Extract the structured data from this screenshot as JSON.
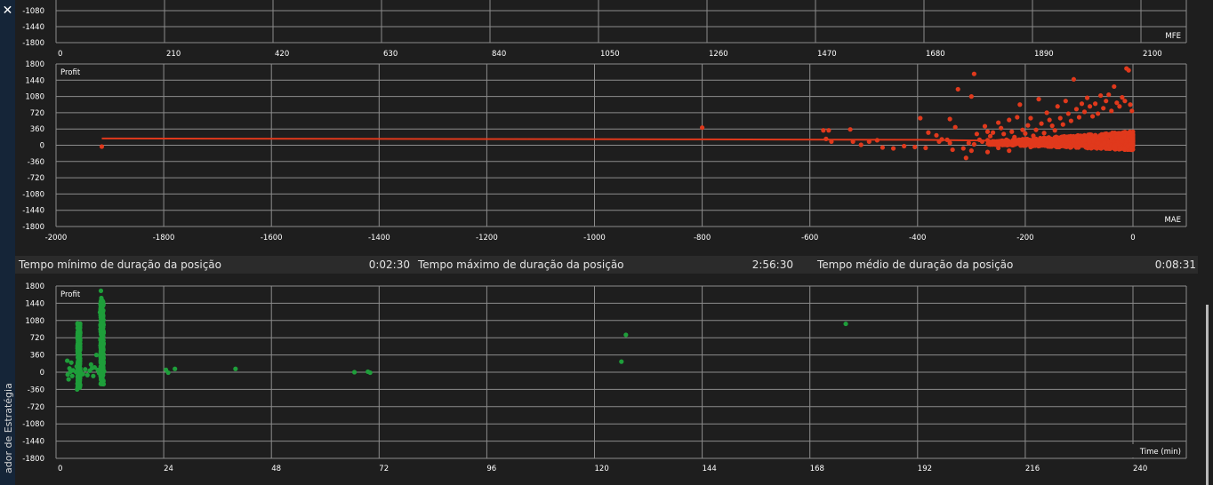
{
  "sidebar": {
    "close_icon": "close-icon",
    "label": "ador de Estratégia"
  },
  "stats": [
    {
      "label": "Tempo mínimo de duração da posição",
      "value": "0:02:30"
    },
    {
      "label": "Tempo máximo de duração da posição",
      "value": "2:56:30"
    },
    {
      "label": "Tempo médio de duração da posição",
      "value": "0:08:31"
    }
  ],
  "chart_data": [
    {
      "type": "scatter",
      "title": "",
      "xlabel": "",
      "ylabel": "",
      "corner_label": "MFE",
      "xlim": [
        0,
        2100
      ],
      "x_ticks": [
        "0",
        "210",
        "420",
        "630",
        "840",
        "1050",
        "1260",
        "1470",
        "1680",
        "1890",
        "2100"
      ],
      "y_ticks_visible": [
        "-1080",
        "-1440",
        "-1800"
      ],
      "grid": true,
      "series": [],
      "color": "#e0391c"
    },
    {
      "type": "scatter",
      "title": "",
      "ylabel": "Profit",
      "xlabel": "MAE",
      "xlim": [
        -2000,
        0
      ],
      "ylim": [
        -1800,
        1800
      ],
      "x_ticks": [
        "-2000",
        "-1800",
        "-1600",
        "-1400",
        "-1200",
        "-1000",
        "-800",
        "-600",
        "-400",
        "-200",
        "0"
      ],
      "y_ticks": [
        "1800",
        "1440",
        "1080",
        "720",
        "360",
        "0",
        "-360",
        "-720",
        "-1080",
        "-1440",
        "-1800"
      ],
      "grid": true,
      "color": "#e0391c",
      "line_points": [
        [
          -1915,
          150
        ],
        [
          -800,
          130
        ],
        [
          -400,
          120
        ],
        [
          0,
          70
        ]
      ],
      "points": [
        [
          -1915,
          -30
        ],
        [
          -800,
          390
        ],
        [
          -575,
          330
        ],
        [
          -565,
          330
        ],
        [
          -570,
          140
        ],
        [
          -560,
          80
        ],
        [
          -525,
          350
        ],
        [
          -520,
          80
        ],
        [
          -505,
          10
        ],
        [
          -490,
          80
        ],
        [
          -475,
          110
        ],
        [
          -465,
          -50
        ],
        [
          -445,
          -70
        ],
        [
          -425,
          -20
        ],
        [
          -405,
          -40
        ],
        [
          -385,
          -60
        ],
        [
          -360,
          80
        ],
        [
          -345,
          120
        ],
        [
          -340,
          50
        ],
        [
          -335,
          -100
        ],
        [
          -315,
          -70
        ],
        [
          -305,
          50
        ],
        [
          -295,
          20
        ],
        [
          -280,
          80
        ],
        [
          -270,
          110
        ],
        [
          -255,
          30
        ],
        [
          -395,
          600
        ],
        [
          -380,
          280
        ],
        [
          -365,
          220
        ],
        [
          -355,
          130
        ],
        [
          -340,
          580
        ],
        [
          -330,
          400
        ],
        [
          -325,
          1240
        ],
        [
          -310,
          -280
        ],
        [
          -300,
          1080
        ],
        [
          -295,
          1580
        ],
        [
          -290,
          250
        ],
        [
          -285,
          120
        ],
        [
          -275,
          420
        ],
        [
          -270,
          300
        ],
        [
          -265,
          200
        ],
        [
          -260,
          280
        ],
        [
          -250,
          500
        ],
        [
          -245,
          380
        ],
        [
          -240,
          250
        ],
        [
          -235,
          120
        ],
        [
          -230,
          560
        ],
        [
          -225,
          300
        ],
        [
          -220,
          180
        ],
        [
          -215,
          620
        ],
        [
          -210,
          900
        ],
        [
          -205,
          340
        ],
        [
          -200,
          260
        ],
        [
          -195,
          440
        ],
        [
          -190,
          600
        ],
        [
          -185,
          210
        ],
        [
          -180,
          340
        ],
        [
          -175,
          1020
        ],
        [
          -170,
          480
        ],
        [
          -165,
          270
        ],
        [
          -160,
          720
        ],
        [
          -155,
          560
        ],
        [
          -150,
          430
        ],
        [
          -145,
          330
        ],
        [
          -140,
          860
        ],
        [
          -135,
          600
        ],
        [
          -130,
          460
        ],
        [
          -125,
          980
        ],
        [
          -120,
          700
        ],
        [
          -115,
          540
        ],
        [
          -110,
          1460
        ],
        [
          -105,
          800
        ],
        [
          -100,
          620
        ],
        [
          -95,
          920
        ],
        [
          -90,
          740
        ],
        [
          -85,
          1050
        ],
        [
          -80,
          860
        ],
        [
          -75,
          640
        ],
        [
          -70,
          920
        ],
        [
          -65,
          700
        ],
        [
          -60,
          1100
        ],
        [
          -55,
          820
        ],
        [
          -50,
          980
        ],
        [
          -45,
          1120
        ],
        [
          -40,
          760
        ],
        [
          -35,
          1300
        ],
        [
          -30,
          940
        ],
        [
          -25,
          860
        ],
        [
          -20,
          1060
        ],
        [
          -15,
          980
        ],
        [
          -12,
          1700
        ],
        [
          -8,
          1660
        ],
        [
          -5,
          900
        ],
        [
          -2,
          760
        ],
        [
          -35,
          -60
        ],
        [
          -80,
          -20
        ],
        [
          -140,
          -10
        ],
        [
          -190,
          -40
        ],
        [
          -230,
          -120
        ],
        [
          -270,
          -150
        ],
        [
          -300,
          -120
        ],
        [
          -250,
          -60
        ],
        [
          -170,
          40
        ],
        [
          -120,
          160
        ],
        [
          -60,
          200
        ],
        [
          -20,
          50
        ]
      ]
    },
    {
      "type": "scatter",
      "title": "",
      "ylabel": "Profit",
      "xlabel": "Time (min)",
      "xlim": [
        0,
        240
      ],
      "ylim": [
        -1800,
        1800
      ],
      "x_ticks": [
        "0",
        "24",
        "48",
        "72",
        "96",
        "120",
        "144",
        "168",
        "192",
        "216",
        "240"
      ],
      "y_ticks": [
        "1800",
        "1440",
        "1080",
        "720",
        "360",
        "0",
        "-360",
        "-720",
        "-1080",
        "-1440",
        "-1800"
      ],
      "grid": true,
      "color": "#1e9e3a",
      "points": [
        [
          2.5,
          240
        ],
        [
          2.6,
          -50
        ],
        [
          2.8,
          -150
        ],
        [
          3.0,
          80
        ],
        [
          3.2,
          10
        ],
        [
          3.4,
          200
        ],
        [
          3.6,
          -80
        ],
        [
          3.8,
          40
        ],
        [
          4.5,
          0
        ],
        [
          4.6,
          120
        ],
        [
          4.7,
          -360
        ],
        [
          4.8,
          1020
        ],
        [
          4.9,
          800
        ],
        [
          5.0,
          600
        ],
        [
          5.0,
          -300
        ],
        [
          5.1,
          400
        ],
        [
          5.2,
          250
        ],
        [
          5.5,
          20
        ],
        [
          6.0,
          -40
        ],
        [
          6.5,
          60
        ],
        [
          7.0,
          -60
        ],
        [
          7.5,
          30
        ],
        [
          7.8,
          160
        ],
        [
          8.0,
          80
        ],
        [
          8.3,
          -80
        ],
        [
          8.6,
          100
        ],
        [
          9.0,
          360
        ],
        [
          9.3,
          50
        ],
        [
          9.6,
          -20
        ],
        [
          9.8,
          1250
        ],
        [
          10.0,
          1700
        ],
        [
          10.1,
          1550
        ],
        [
          10.2,
          1200
        ],
        [
          10.3,
          900
        ],
        [
          10.4,
          600
        ],
        [
          10.5,
          300
        ],
        [
          10.6,
          -250
        ],
        [
          10.7,
          20
        ],
        [
          24.5,
          50
        ],
        [
          25,
          -10
        ],
        [
          26.5,
          70
        ],
        [
          40,
          70
        ],
        [
          66.5,
          0
        ],
        [
          69.5,
          10
        ],
        [
          70,
          -10
        ],
        [
          126,
          220
        ],
        [
          127,
          780
        ],
        [
          176,
          1010
        ]
      ]
    }
  ]
}
